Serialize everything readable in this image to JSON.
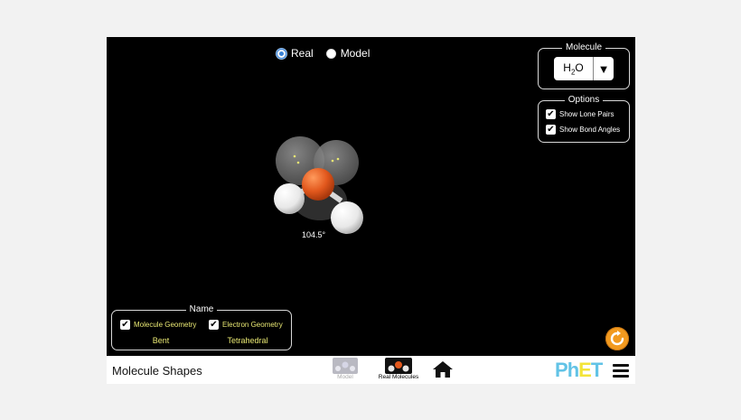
{
  "radio": {
    "real_label": "Real",
    "model_label": "Model",
    "selected": "Real"
  },
  "molecule_panel": {
    "title": "Molecule",
    "value_main": "H",
    "value_sub": "2",
    "value_tail": "O"
  },
  "options_panel": {
    "title": "Options",
    "show_lone_pairs": {
      "label": "Show Lone Pairs",
      "checked": true
    },
    "show_bond_angles": {
      "label": "Show Bond Angles",
      "checked": true
    }
  },
  "name_panel": {
    "title": "Name",
    "molecule_geometry": {
      "label": "Molecule Geometry",
      "checked": true,
      "value": "Bent"
    },
    "electron_geometry": {
      "label": "Electron Geometry",
      "checked": true,
      "value": "Tetrahedral"
    }
  },
  "bond_angle": "104.5°",
  "navbar": {
    "sim_title": "Molecule Shapes",
    "screens": [
      {
        "label": "Model",
        "selected": false
      },
      {
        "label": "Real Molecules",
        "selected": true
      }
    ],
    "logo": {
      "p": "P",
      "h": "h",
      "e": "E",
      "t": "T"
    }
  },
  "icons": [
    "radio-icon",
    "dropdown-arrow-icon",
    "checkbox-icon",
    "reset-icon",
    "home-icon",
    "menu-icon"
  ],
  "colors": {
    "background": "#000000",
    "oxygen": "#e2581d",
    "hydrogen": "#ffffff",
    "label_yellow": "#e9e873",
    "reset": "#f29a1f",
    "radio_selected": "#3a82d6"
  }
}
